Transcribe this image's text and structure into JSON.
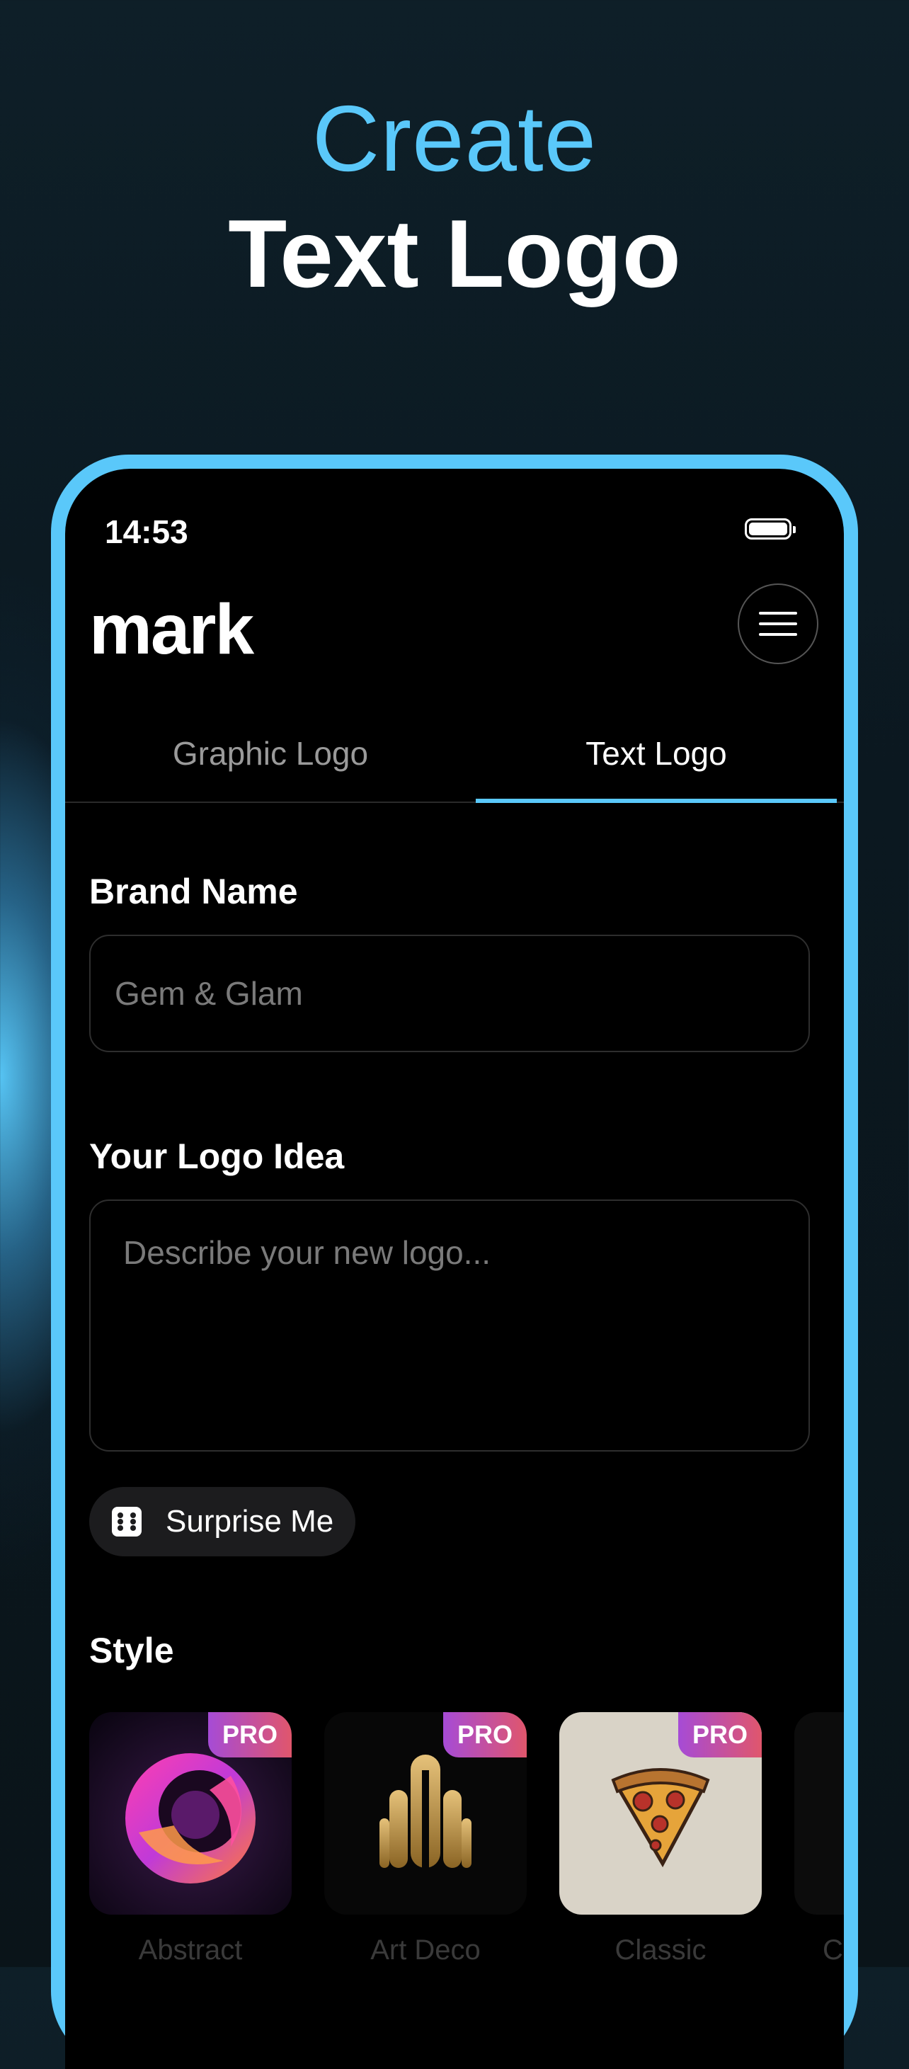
{
  "promo": {
    "line1": "Create",
    "line2": "Text Logo"
  },
  "status_bar": {
    "time": "14:53"
  },
  "app": {
    "logo": "mark",
    "menu_icon": "hamburger-menu-icon"
  },
  "tabs": [
    {
      "label": "Graphic Logo",
      "selected": false
    },
    {
      "label": "Text Logo",
      "selected": true
    }
  ],
  "form": {
    "brand_name_label": "Brand Name",
    "brand_name_placeholder": "Gem & Glam",
    "logo_idea_label": "Your Logo Idea",
    "logo_idea_placeholder": "Describe your new logo...",
    "surprise_label": "Surprise Me",
    "surprise_icon": "dice-icon"
  },
  "style": {
    "label": "Style",
    "badge": "PRO",
    "items": [
      {
        "name": "Abstract",
        "pro": true
      },
      {
        "name": "Art Deco",
        "pro": true
      },
      {
        "name": "Classic",
        "pro": true
      },
      {
        "name": "C",
        "pro": false
      }
    ]
  },
  "colors": {
    "accent": "#5ac8fa",
    "background": "#000000",
    "pro_gradient_start": "#a64bd6",
    "pro_gradient_end": "#e0566c"
  }
}
